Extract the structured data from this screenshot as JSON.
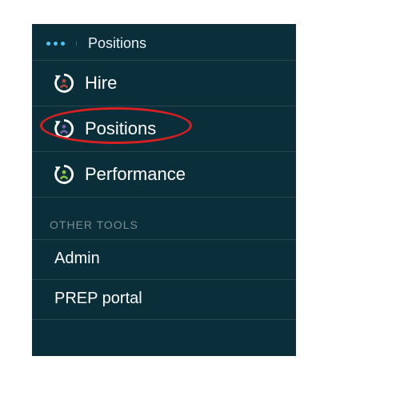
{
  "header": {
    "breadcrumb": "Positions"
  },
  "icon_colors": {
    "hire": "#b54b3a",
    "positions": "#7a5fb3",
    "performance": "#8fc743"
  },
  "nav_items": [
    {
      "label": "Hire",
      "icon": "cycle-person",
      "dot": "hire"
    },
    {
      "label": "Positions",
      "icon": "cycle-person",
      "dot": "positions"
    },
    {
      "label": "Performance",
      "icon": "cycle-person",
      "dot": "performance"
    }
  ],
  "other_tools": {
    "section_label": "OTHER TOOLS",
    "items": [
      {
        "label": "Admin"
      },
      {
        "label": "PREP portal"
      }
    ]
  }
}
